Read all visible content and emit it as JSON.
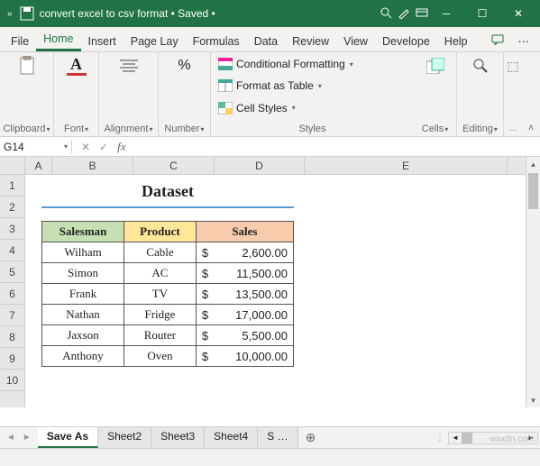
{
  "title": "convert excel to csv format • Saved •",
  "tabs": {
    "file": "File",
    "home": "Home",
    "insert": "Insert",
    "pagelay": "Page Lay",
    "formulas": "Formulas",
    "data": "Data",
    "review": "Review",
    "view": "View",
    "develope": "Develope",
    "help": "Help"
  },
  "ribbon": {
    "clipboard": "Clipboard",
    "font": "Font",
    "alignment": "Alignment",
    "number": "Number",
    "cond_fmt": "Conditional Formatting",
    "fmt_table": "Format as Table",
    "cell_styles": "Cell Styles",
    "styles": "Styles",
    "cells": "Cells",
    "editing": "Editing"
  },
  "namebox": "G14",
  "fx_label": "fx",
  "columns": [
    "A",
    "B",
    "C",
    "D",
    "E"
  ],
  "rows": [
    "1",
    "2",
    "3",
    "4",
    "5",
    "6",
    "7",
    "8",
    "9",
    "10"
  ],
  "dataset_title": "Dataset",
  "headers": {
    "salesman": "Salesman",
    "product": "Product",
    "sales": "Sales"
  },
  "data_rows": [
    {
      "salesman": "Wilham",
      "product": "Cable",
      "cur": "$",
      "amount": "2,600.00"
    },
    {
      "salesman": "Simon",
      "product": "AC",
      "cur": "$",
      "amount": "11,500.00"
    },
    {
      "salesman": "Frank",
      "product": "TV",
      "cur": "$",
      "amount": "13,500.00"
    },
    {
      "salesman": "Nathan",
      "product": "Fridge",
      "cur": "$",
      "amount": "17,000.00"
    },
    {
      "salesman": "Jaxson",
      "product": "Router",
      "cur": "$",
      "amount": "5,500.00"
    },
    {
      "salesman": "Anthony",
      "product": "Oven",
      "cur": "$",
      "amount": "10,000.00"
    }
  ],
  "sheets": {
    "active": "Save As",
    "others": [
      "Sheet2",
      "Sheet3",
      "Sheet4",
      "S …"
    ]
  },
  "watermark": "wsxdn.com"
}
